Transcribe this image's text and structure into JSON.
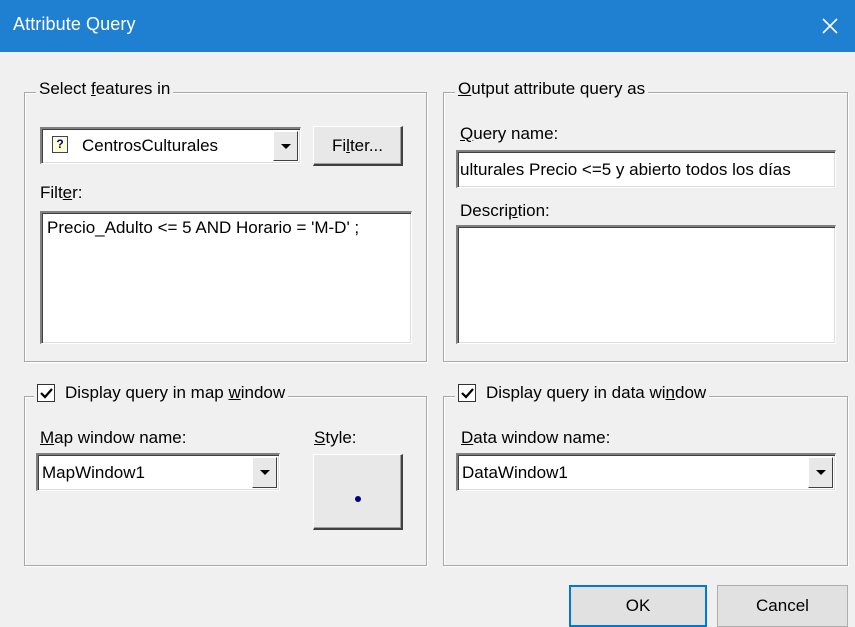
{
  "window": {
    "title": "Attribute Query"
  },
  "select_features": {
    "legend_pre": "Select ",
    "legend_accel": "f",
    "legend_post": "eatures in",
    "layer_value": "CentrosCulturales",
    "filter_button_pre": "Fi",
    "filter_button_accel": "l",
    "filter_button_post": "ter...",
    "filter_label_pre": "Filt",
    "filter_label_accel": "e",
    "filter_label_post": "r:",
    "filter_text": "Precio_Adulto <= 5 AND Horario = 'M-D' ;"
  },
  "output": {
    "legend_pre": "",
    "legend_accel": "O",
    "legend_post": "utput attribute query as",
    "query_name_label_pre": "",
    "query_name_label_accel": "Q",
    "query_name_label_post": "uery name:",
    "query_name_value": "ulturales Precio <=5 y abierto todos los días",
    "description_label_pre": "Descri",
    "description_label_accel": "p",
    "description_label_post": "tion:",
    "description_value": ""
  },
  "map_window": {
    "checkbox_label_pre": "Display query in map ",
    "checkbox_label_accel": "w",
    "checkbox_label_post": "indow",
    "checked": true,
    "name_label_pre": "",
    "name_label_accel": "M",
    "name_label_post": "ap window name:",
    "name_value": "MapWindow1",
    "style_label_pre": "",
    "style_label_accel": "S",
    "style_label_post": "tyle:"
  },
  "data_window": {
    "checkbox_label_pre": "Display query in data wi",
    "checkbox_label_accel": "n",
    "checkbox_label_post": "dow",
    "checked": true,
    "name_label_pre": "",
    "name_label_accel": "D",
    "name_label_post": "ata window name:",
    "name_value": "DataWindow1"
  },
  "buttons": {
    "ok": "OK",
    "cancel": "Cancel"
  },
  "colors": {
    "titlebar": "#1f7fd1",
    "face": "#f0f0f0",
    "style_dot": "#000080"
  }
}
